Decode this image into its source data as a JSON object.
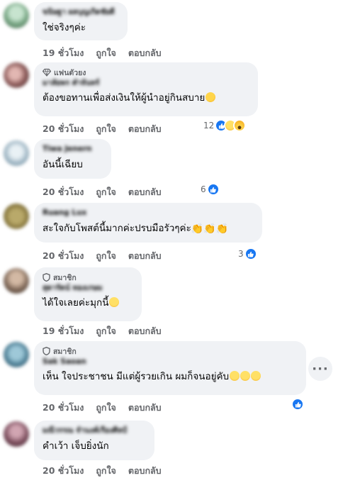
{
  "comments": [
    {
      "name": "ขนิษฐา ผลบุญเกิดชัยดี",
      "text": "ใช่จริงๆค่ะ",
      "time": "19 ชั่วโมง",
      "like": "ถูกใจ",
      "reply": "ตอบกลับ"
    },
    {
      "badge": "แฟนตัวยง",
      "name": "มาลัยพร คำจันทร์",
      "text": "ต้องขอทานเพื่อส่งเงินให้ผู้นำอยู่กินสบาย",
      "time": "20 ชั่วโมง",
      "like": "ถูกใจ",
      "reply": "ตอบกลับ",
      "react_count": "12"
    },
    {
      "name": "Tiwa Jenern",
      "text": "อันนี้เฉียบ",
      "time": "20 ชั่วโมง",
      "like": "ถูกใจ",
      "reply": "ตอบกลับ",
      "react_count": "6"
    },
    {
      "name": "Ruang Lux",
      "text": "สะใจกับโพสต์นี้มากค่ะปรบมือรัวๆค่ะ",
      "time": "20 ชั่วโมง",
      "like": "ถูกใจ",
      "reply": "ตอบกลับ",
      "react_count": "3"
    },
    {
      "badge": "สมาชิก",
      "name": "สุดารัตน์ ทองเกษม",
      "text": "ได้ใจเลยค่ะมุกนี้",
      "time": "19 ชั่วโมง",
      "like": "ถูกใจ",
      "reply": "ตอบกลับ"
    },
    {
      "badge": "สมาชิก",
      "name": "Sak Saoan",
      "text": "เห็น ใจประชาชน มีแต่ผู้รวยเกิน ผมก็จนอยู่คับ",
      "time": "20 ชั่วโมง",
      "like": "ถูกใจ",
      "reply": "ตอบกลับ"
    },
    {
      "name": "มณีวรรณ จำนงค์เรืองศิลป์",
      "text": "คำเว้า เจ็บยิ่งนัก",
      "time": "20 ชั่วโมง",
      "like": "ถูกใจ",
      "reply": "ตอบกลับ"
    }
  ],
  "more_options_glyph": "···",
  "colors": {
    "like_blue": "#1877f2",
    "bubble_bg": "#f0f2f5",
    "meta_gray": "#65676b"
  }
}
